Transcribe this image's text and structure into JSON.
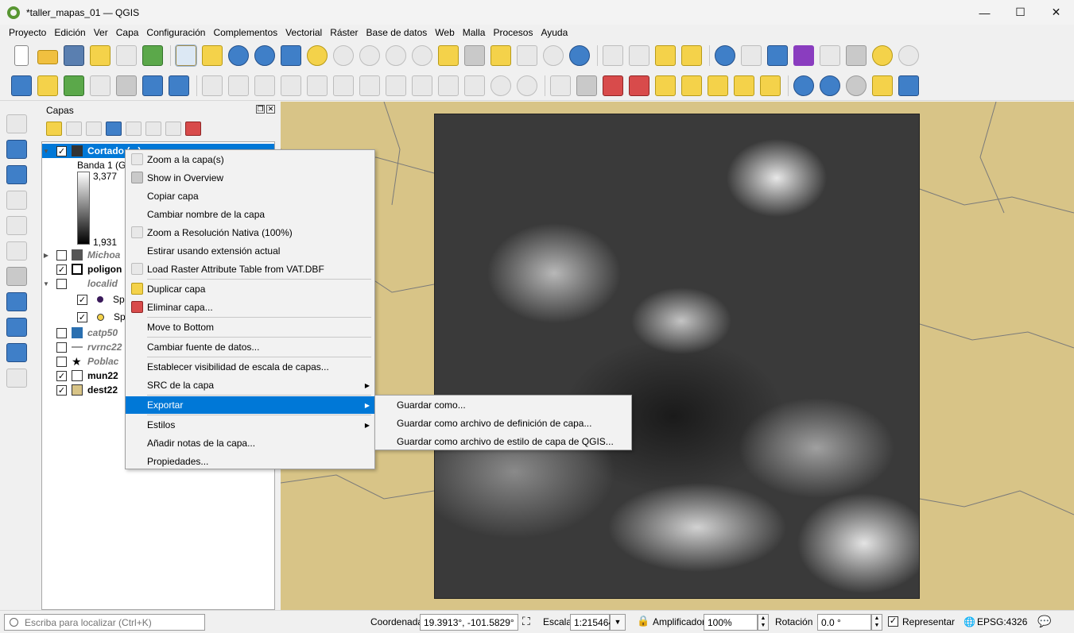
{
  "window": {
    "title": "*taller_mapas_01 — QGIS",
    "minimize": "—",
    "maximize": "☐",
    "close": "✕"
  },
  "menubar": [
    "Proyecto",
    "Edición",
    "Ver",
    "Capa",
    "Configuración",
    "Complementos",
    "Vectorial",
    "Ráster",
    "Base de datos",
    "Web",
    "Malla",
    "Procesos",
    "Ayuda"
  ],
  "panel": {
    "title": "Capas",
    "float_btn": "❐",
    "close_btn": "✕"
  },
  "layers": [
    {
      "name": "Cortado (...)",
      "checked": true,
      "expanded": true,
      "selected": true,
      "style": "bold"
    },
    {
      "name": "Banda 1 (Gr",
      "legend": true
    },
    {
      "name": "3,377",
      "legend": true
    },
    {
      "name": "1,931",
      "legend": true
    },
    {
      "name": "Michoa",
      "checked": false,
      "style": "italic"
    },
    {
      "name": "poligon",
      "checked": true,
      "style": "bold"
    },
    {
      "name": "localid",
      "checked": false,
      "style": "italic"
    },
    {
      "name": "Sp",
      "checked": true,
      "symbol": "purple-dot"
    },
    {
      "name": "Sp",
      "checked": true,
      "symbol": "yellow-dot"
    },
    {
      "name": "catp50",
      "checked": false,
      "style": "italic"
    },
    {
      "name": "rvrnc22",
      "checked": false,
      "style": "italic"
    },
    {
      "name": "Poblac",
      "checked": false,
      "style": "italic"
    },
    {
      "name": "mun22",
      "checked": true,
      "style": "bold"
    },
    {
      "name": "dest22",
      "checked": true,
      "style": "bold"
    }
  ],
  "context_menu": {
    "items": [
      "Zoom a la capa(s)",
      "Show in Overview",
      "Copiar capa",
      "Cambiar nombre de la capa",
      "Zoom a Resolución Nativa (100%)",
      "Estirar usando extensión actual",
      "Load Raster Attribute Table from VAT.DBF",
      "Duplicar capa",
      "Eliminar capa...",
      "Move to Bottom",
      "Cambiar fuente de datos...",
      "Establecer visibilidad de escala de capas...",
      "SRC de la capa",
      "Exportar",
      "Estilos",
      "Añadir notas de la capa...",
      "Propiedades..."
    ]
  },
  "export_submenu": {
    "items": [
      "Guardar como...",
      "Guardar como archivo de definición de capa...",
      "Guardar como archivo de estilo de capa de QGIS..."
    ]
  },
  "statusbar": {
    "locator_placeholder": "Escriba para localizar (Ctrl+K)",
    "coord_label": "Coordenada",
    "coord_value": "19.3913°, -101.5829°",
    "scale_label": "Escala",
    "scale_value": "1:215464",
    "magnifier_label": "Amplificador",
    "magnifier_value": "100%",
    "rotation_label": "Rotación",
    "rotation_value": "0.0 °",
    "render_label": "Representar",
    "crs_label": "EPSG:4326"
  },
  "colors": {
    "map_background": "#d8c487",
    "selection": "#0078d7",
    "menu_background": "#f2f2f2"
  }
}
